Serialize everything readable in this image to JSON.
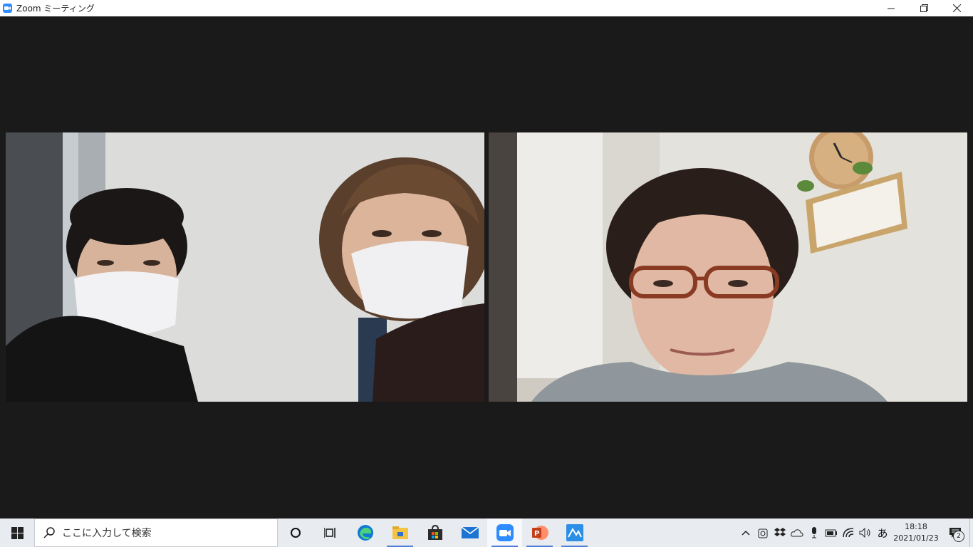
{
  "window": {
    "title": "Zoom ミーティング",
    "minimize_label": "—",
    "restore_label": "❐",
    "close_label": "✕"
  },
  "participants": [
    {
      "video": "two-people-masked"
    },
    {
      "video": "woman-with-glasses"
    }
  ],
  "taskbar": {
    "search_placeholder": "ここに入力して検索",
    "apps": [
      "cortana",
      "task-view",
      "edge",
      "file-explorer",
      "microsoft-store",
      "mail",
      "zoom",
      "powerpoint",
      "photo-app"
    ],
    "ime_label": "あ",
    "time": "18:18",
    "date": "2021/01/23",
    "notification_count": "2"
  },
  "colors": {
    "stage_bg": "#1a1a1a",
    "zoom_blue": "#2d8cff",
    "taskbar_bg": "#e8ecf1",
    "running_indicator": "#4f7fd8"
  }
}
